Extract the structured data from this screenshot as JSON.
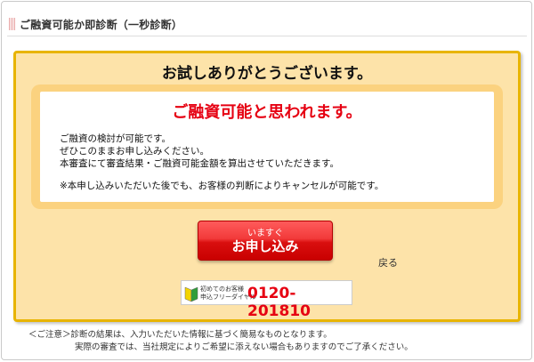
{
  "header": {
    "title": "ご融資可能か即診断（一秒診断）"
  },
  "result": {
    "thanks": "お試しありがとうございます。",
    "possible": "ご融資可能と思われます。",
    "messages": [
      "ご融資の検討が可能です。",
      "ぜひこのままお申し込みください。",
      "本審査にて審査結果・ご融資可能金額を算出させていただきます。",
      "※本申し込みいただいた後でも、お客様の判断によりキャンセルが可能です。"
    ]
  },
  "apply_button": {
    "small": "いますぐ",
    "label": "お申し込み"
  },
  "back_link": "戻る",
  "phone": {
    "note_line1": "初めてのお客様",
    "note_line2": "申込フリーダイヤル",
    "number": "0120-201810",
    "icon": "beginner-mark-icon"
  },
  "notes": [
    "＜ご注意＞診断の結果は、入力いただいた情報に基づく簡易なものとなります。",
    "実際の審査では、当社規定によりご希望に添えない場合もありますのでご了承ください。"
  ],
  "colors": {
    "accent_red": "#e60012",
    "panel_bg": "#fde3a9",
    "panel_border": "#e8b400",
    "inner_bg": "#fbd27f"
  }
}
